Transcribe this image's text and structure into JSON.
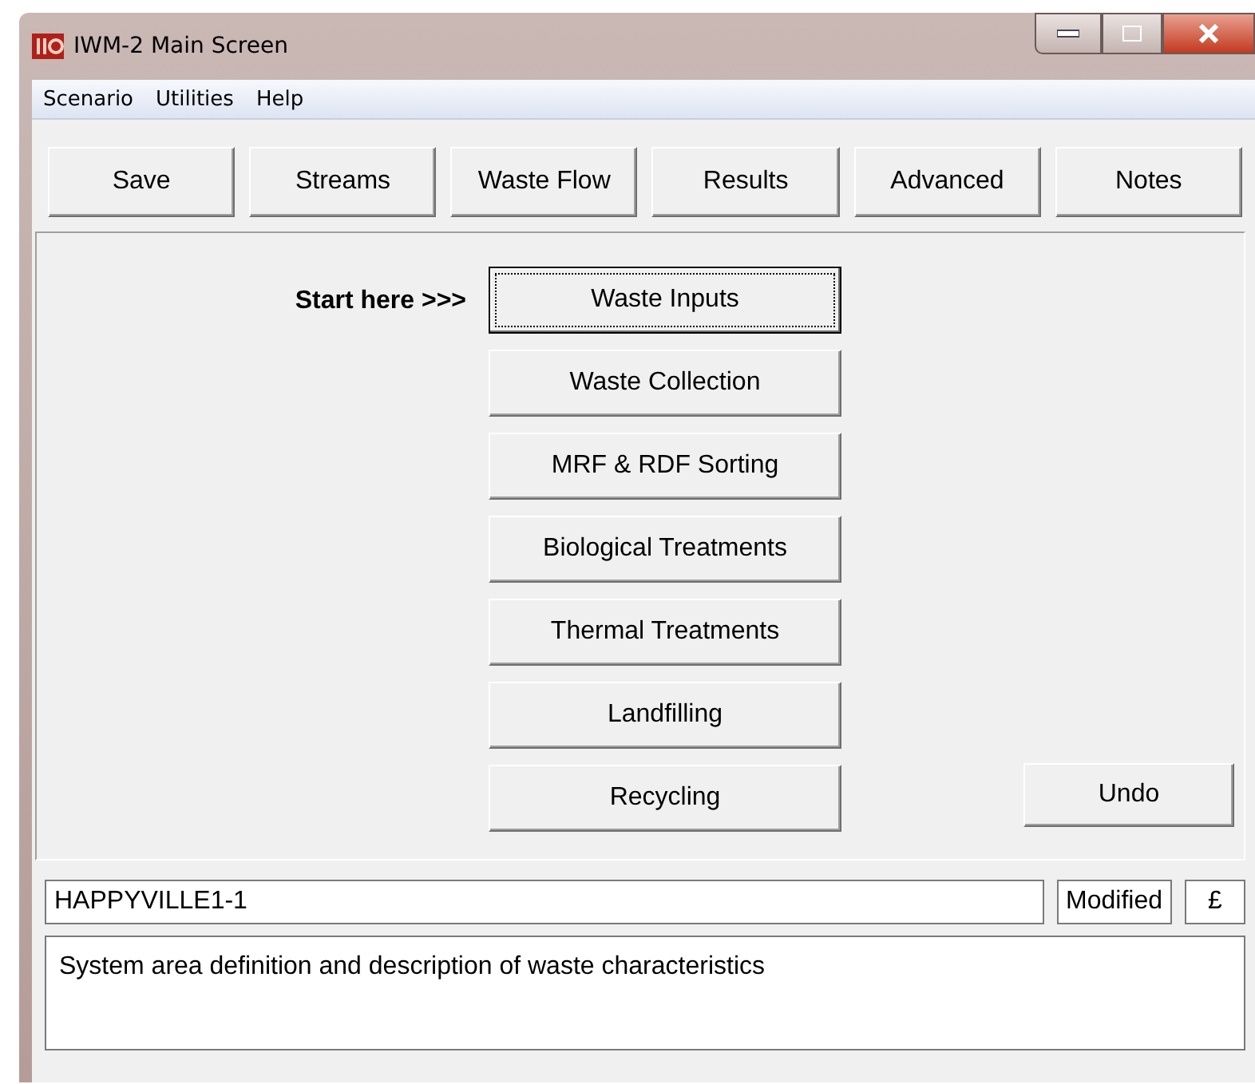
{
  "window": {
    "title": "IWM-2 Main Screen"
  },
  "menu": [
    "Scenario",
    "Utilities",
    "Help"
  ],
  "toolbar": [
    "Save",
    "Streams",
    "Waste Flow",
    "Results",
    "Advanced",
    "Notes"
  ],
  "start_label": "Start here >>>",
  "stages": [
    {
      "label": "Waste Inputs",
      "focused": true
    },
    {
      "label": "Waste Collection",
      "focused": false
    },
    {
      "label": "MRF & RDF Sorting",
      "focused": false
    },
    {
      "label": "Biological Treatments",
      "focused": false
    },
    {
      "label": "Thermal Treatments",
      "focused": false
    },
    {
      "label": "Landfilling",
      "focused": false
    },
    {
      "label": "Recycling",
      "focused": false
    }
  ],
  "undo": "Undo",
  "status": {
    "scenario": "HAPPYVILLE1-1",
    "state": "Modified",
    "currency": "£"
  },
  "description": "System area definition and description of waste characteristics"
}
